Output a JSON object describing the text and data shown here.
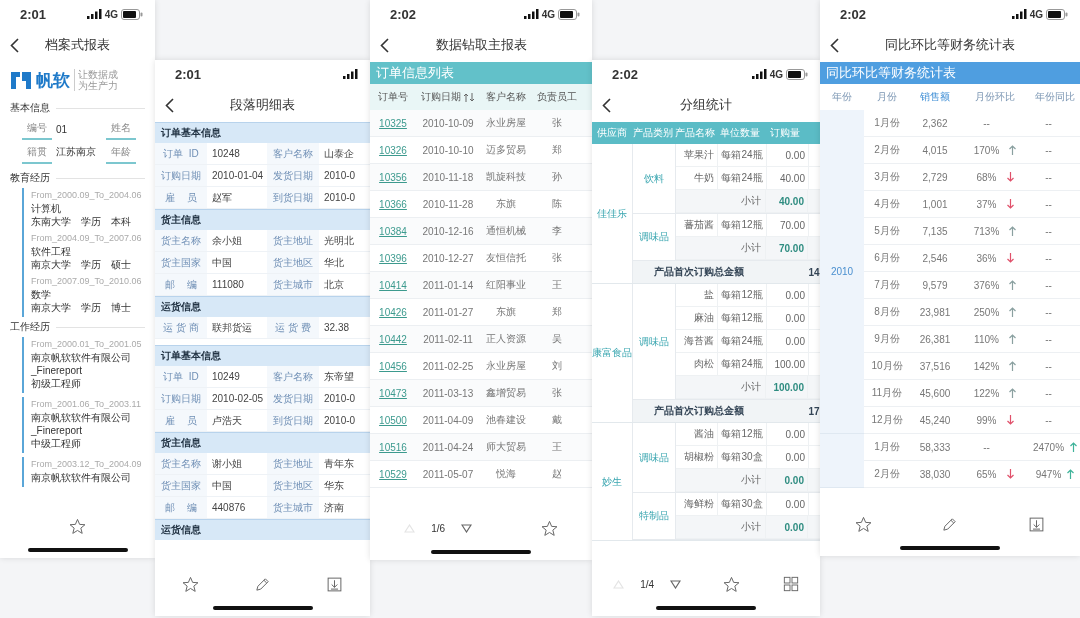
{
  "phones": [
    {
      "kind": "profile",
      "time": "2:01",
      "network": "4G",
      "title": "档案式报表",
      "logo": {
        "name": "帆软",
        "tagline": "让数据成为生产力"
      },
      "basic": {
        "title": "基本信息",
        "fields": [
          {
            "label": "编号",
            "value": "01"
          },
          {
            "label": "姓名"
          },
          {
            "label": "籍贯",
            "value": "江苏南京"
          },
          {
            "label": "年龄"
          }
        ]
      },
      "education": {
        "title": "教育经历",
        "entries": [
          {
            "period": "From_2000.09_To_2004.06",
            "major": "计算机",
            "school": "东南大学",
            "degree_label": "学历",
            "degree": "本科"
          },
          {
            "period": "From_2004.09_To_2007.06",
            "major": "软件工程",
            "school": "南京大学",
            "degree_label": "学历",
            "degree": "硕士"
          },
          {
            "period": "From_2007.09_To_2010.06",
            "major": "数学",
            "school": "南京大学",
            "degree_label": "学历",
            "degree": "博士"
          }
        ]
      },
      "work": {
        "title": "工作经历",
        "entries": [
          {
            "period": "From_2000.01_To_2001.05",
            "company": "南京帆软软件有限公司_Finereport",
            "position": "初级工程师"
          },
          {
            "period": "From_2001.06_To_2003.11",
            "company": "南京帆软软件有限公司_Finereport",
            "position": "中级工程师"
          },
          {
            "period": "From_2003.12_To_2004.09",
            "company": "南京帆软软件有限公司"
          }
        ]
      },
      "toolbar": [
        {
          "kind": "star"
        }
      ]
    },
    {
      "kind": "detail",
      "time": "2:01",
      "title": "段落明细表",
      "records": [
        {
          "sections": [
            {
              "title": "订单基本信息",
              "rows": [
                [
                  "订单  ID",
                  "10248",
                  "客户名称",
                  "山泰企"
                ],
                [
                  "订购日期",
                  "2010-01-04",
                  "发货日期",
                  "2010-0"
                ],
                [
                  "雇    员",
                  "赵军",
                  "到货日期",
                  "2010-0"
                ]
              ]
            },
            {
              "title": "货主信息",
              "rows": [
                [
                  "货主名称",
                  "余小姐",
                  "货主地址",
                  "光明北"
                ],
                [
                  "货主国家",
                  "中国",
                  "货主地区",
                  "华北"
                ],
                [
                  "邮    编",
                  "111080",
                  "货主城市",
                  "北京"
                ]
              ]
            },
            {
              "title": "运货信息",
              "rows": [
                [
                  "运 货 商",
                  "联邦货运",
                  "运 货 费",
                  "32.38"
                ]
              ]
            }
          ]
        },
        {
          "sections": [
            {
              "title": "订单基本信息",
              "rows": [
                [
                  "订单  ID",
                  "10249",
                  "客户名称",
                  "东帝望"
                ],
                [
                  "订购日期",
                  "2010-02-05",
                  "发货日期",
                  "2010-0"
                ],
                [
                  "雇    员",
                  "卢浩天",
                  "到货日期",
                  "2010-0"
                ]
              ]
            },
            {
              "title": "货主信息",
              "rows": [
                [
                  "货主名称",
                  "谢小姐",
                  "货主地址",
                  "青年东"
                ],
                [
                  "货主国家",
                  "中国",
                  "货主地区",
                  "华东"
                ],
                [
                  "邮    编",
                  "440876",
                  "货主城市",
                  "济南"
                ]
              ]
            },
            {
              "title": "运货信息"
            }
          ]
        }
      ],
      "toolbar": [
        {
          "kind": "star"
        },
        {
          "kind": "edit"
        },
        {
          "kind": "download"
        }
      ]
    },
    {
      "kind": "list",
      "time": "2:02",
      "network": "4G",
      "title": "数据钻取主报表",
      "banner": "订单信息列表",
      "columns": [
        "订单号",
        "订购日期",
        "客户名称",
        "负责员工"
      ],
      "rows": [
        [
          "10325",
          "2010-10-09",
          "永业房屋",
          "张"
        ],
        [
          "10326",
          "2010-10-10",
          "迈多贸易",
          "郑"
        ],
        [
          "10356",
          "2010-11-18",
          "凯旋科技",
          "孙"
        ],
        [
          "10366",
          "2010-11-28",
          "东旗",
          "陈"
        ],
        [
          "10384",
          "2010-12-16",
          "通恒机械",
          "李"
        ],
        [
          "10396",
          "2010-12-27",
          "友恒信托",
          "张"
        ],
        [
          "10414",
          "2011-01-14",
          "红阳事业",
          "王"
        ],
        [
          "10426",
          "2011-01-27",
          "东旗",
          "郑"
        ],
        [
          "10442",
          "2011-02-11",
          "正人资源",
          "吴"
        ],
        [
          "10456",
          "2011-02-25",
          "永业房屋",
          "刘"
        ],
        [
          "10473",
          "2011-03-13",
          "鑫增贸易",
          "张"
        ],
        [
          "10500",
          "2011-04-09",
          "池春建设",
          "戴"
        ],
        [
          "10516",
          "2011-04-24",
          "师大贸易",
          "王"
        ],
        [
          "10529",
          "2011-05-07",
          "悦海",
          "赵"
        ]
      ],
      "pager": "1/6",
      "toolbar": [
        {
          "kind": "star"
        }
      ]
    },
    {
      "kind": "group",
      "time": "2:02",
      "network": "4G",
      "title": "分组统计",
      "columns": [
        "供应商",
        "产品类别",
        "产品名称",
        "单位数量",
        "订购量"
      ],
      "suppliers": [
        {
          "name": "佳佳乐",
          "categories": [
            {
              "name": "饮料",
              "items": [
                {
                  "product": "苹果汁",
                  "unit": "每箱24瓶",
                  "qty": "0.00"
                },
                {
                  "product": "牛奶",
                  "unit": "每箱24瓶",
                  "qty": "40.00"
                }
              ],
              "subtotal_label": "小计",
              "subtotal": "40.00"
            },
            {
              "name": "调味品",
              "items": [
                {
                  "product": "蕃茄酱",
                  "unit": "每箱12瓶",
                  "qty": "70.00"
                }
              ],
              "subtotal_label": "小计",
              "subtotal": "70.00"
            }
          ],
          "total_label": "产品首次订购总金额",
          "total": "14"
        },
        {
          "name": "康富食品",
          "categories": [
            {
              "name": "调味品",
              "items": [
                {
                  "product": "盐",
                  "unit": "每箱12瓶",
                  "qty": "0.00"
                },
                {
                  "product": "麻油",
                  "unit": "每箱12瓶",
                  "qty": "0.00"
                },
                {
                  "product": "海苔酱",
                  "unit": "每箱24瓶",
                  "qty": "0.00"
                },
                {
                  "product": "肉松",
                  "unit": "每箱24瓶",
                  "qty": "100.00"
                }
              ],
              "subtotal_label": "小计",
              "subtotal": "100.00"
            }
          ],
          "total_label": "产品首次订购总金额",
          "total": "17"
        },
        {
          "name": "妙生",
          "categories": [
            {
              "name": "调味品",
              "items": [
                {
                  "product": "酱油",
                  "unit": "每箱12瓶",
                  "qty": "0.00"
                },
                {
                  "product": "胡椒粉",
                  "unit": "每箱30盒",
                  "qty": "0.00"
                }
              ],
              "subtotal_label": "小计",
              "subtotal": "0.00"
            },
            {
              "name": "特制品",
              "items": [
                {
                  "product": "海鲜粉",
                  "unit": "每箱30盒",
                  "qty": "0.00"
                }
              ],
              "subtotal_label": "小计",
              "subtotal": "0.00"
            }
          ]
        }
      ],
      "pager": "1/4",
      "toolbar": [
        {
          "kind": "star"
        },
        {
          "kind": "grid"
        }
      ]
    },
    {
      "kind": "finance",
      "time": "2:02",
      "network": "4G",
      "title": "同比环比等财务统计表",
      "banner": "同比环比等财务统计表",
      "columns": [
        "年份",
        "月份",
        "销售额",
        "月份环比",
        "年份同比"
      ],
      "groups": [
        {
          "year": "2010",
          "rows": [
            {
              "month": "1月份",
              "sales": "2,362",
              "mom": "--",
              "yoy": "--"
            },
            {
              "month": "2月份",
              "sales": "4,015",
              "mom": "170%",
              "mom_trend": {
                "kind": "up"
              },
              "yoy": "--"
            },
            {
              "month": "3月份",
              "sales": "2,729",
              "mom": "68%",
              "mom_trend": {
                "kind": "down"
              },
              "yoy": "--"
            },
            {
              "month": "4月份",
              "sales": "1,001",
              "mom": "37%",
              "mom_trend": {
                "kind": "down"
              },
              "yoy": "--"
            },
            {
              "month": "5月份",
              "sales": "7,135",
              "mom": "713%",
              "mom_trend": {
                "kind": "up"
              },
              "yoy": "--"
            },
            {
              "month": "6月份",
              "sales": "2,546",
              "mom": "36%",
              "mom_trend": {
                "kind": "down"
              },
              "yoy": "--"
            },
            {
              "month": "7月份",
              "sales": "9,579",
              "mom": "376%",
              "mom_trend": {
                "kind": "up"
              },
              "yoy": "--"
            },
            {
              "month": "8月份",
              "sales": "23,981",
              "mom": "250%",
              "mom_trend": {
                "kind": "up"
              },
              "yoy": "--"
            },
            {
              "month": "9月份",
              "sales": "26,381",
              "mom": "110%",
              "mom_trend": {
                "kind": "up"
              },
              "yoy": "--"
            },
            {
              "month": "10月份",
              "sales": "37,516",
              "mom": "142%",
              "mom_trend": {
                "kind": "up"
              },
              "yoy": "--"
            },
            {
              "month": "11月份",
              "sales": "45,600",
              "mom": "122%",
              "mom_trend": {
                "kind": "up"
              },
              "yoy": "--"
            },
            {
              "month": "12月份",
              "sales": "45,240",
              "mom": "99%",
              "mom_trend": {
                "kind": "down"
              },
              "yoy": "--"
            }
          ]
        },
        {
          "rows": [
            {
              "month": "1月份",
              "sales": "58,333",
              "mom": "--",
              "yoy": "2470%",
              "yoy_trend": {
                "kind": "up"
              }
            },
            {
              "month": "2月份",
              "sales": "38,030",
              "mom": "65%",
              "mom_trend": {
                "kind": "down"
              },
              "yoy": "947%",
              "yoy_trend": {
                "kind": "up"
              }
            }
          ]
        }
      ],
      "toolbar": [
        {
          "kind": "star"
        },
        {
          "kind": "edit"
        },
        {
          "kind": "download"
        }
      ]
    }
  ]
}
